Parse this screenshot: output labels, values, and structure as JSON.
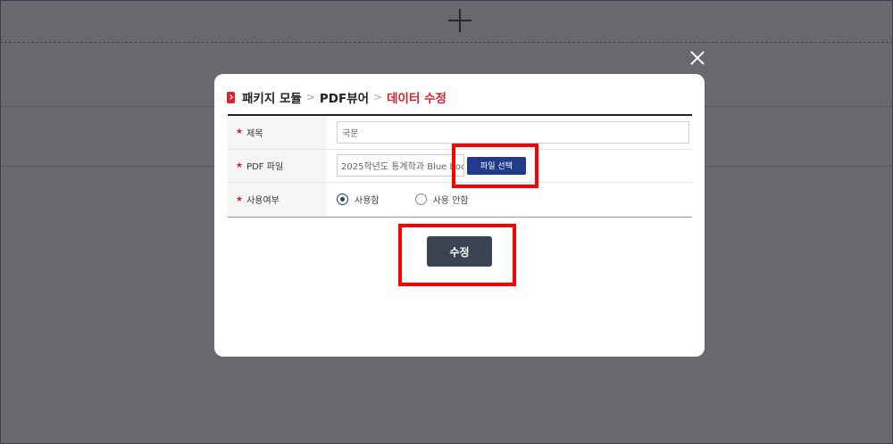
{
  "breadcrumb": {
    "items": [
      "패키지 모듈",
      "PDF뷰어"
    ],
    "active": "데이터 수정"
  },
  "form": {
    "title_label": "제목",
    "title_value": "국문",
    "pdf_label": "PDF 파일",
    "pdf_value": "2025학년도 통계학과 Blue boo",
    "pdf_button": "파일 선택",
    "usage_label": "사용여부",
    "usage_options": [
      "사용함",
      "사용 안함"
    ],
    "usage_selected": "사용함"
  },
  "submit_label": "수정",
  "colors": {
    "accent": "#d8232a",
    "file_button": "#1f3c8a",
    "submit_button": "#3b4251",
    "highlight": "#ff0000"
  }
}
